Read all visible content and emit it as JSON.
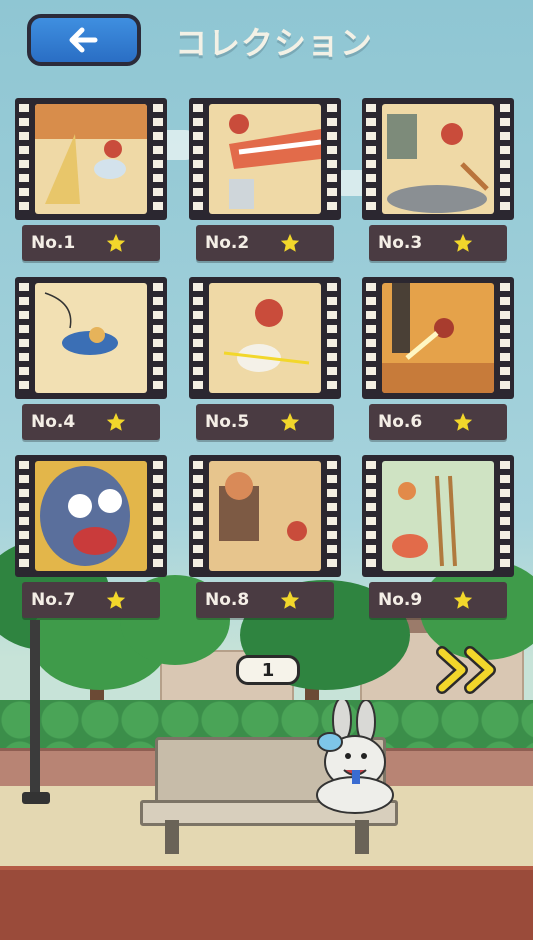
{
  "header": {
    "title": "コレクション",
    "back_icon": "arrow-left-icon",
    "back_button_color": "#2f79d2"
  },
  "collection": {
    "items": [
      {
        "label": "No.1",
        "starred": true
      },
      {
        "label": "No.2",
        "starred": true
      },
      {
        "label": "No.3",
        "starred": true
      },
      {
        "label": "No.4",
        "starred": true
      },
      {
        "label": "No.5",
        "starred": true
      },
      {
        "label": "No.6",
        "starred": true
      },
      {
        "label": "No.7",
        "starred": true
      },
      {
        "label": "No.8",
        "starred": true
      },
      {
        "label": "No.9",
        "starred": true
      }
    ],
    "star_color": "#f2d72b"
  },
  "pagination": {
    "current_page": "1",
    "next_icon": "double-chevron-right-icon"
  }
}
